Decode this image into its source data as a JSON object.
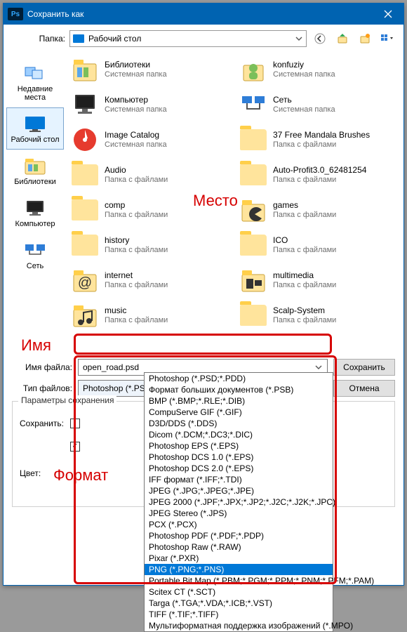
{
  "title": "Сохранить как",
  "folder_label": "Папка:",
  "folder_value": "Рабочий стол",
  "sidebar": [
    {
      "label": "Недавние\nместа",
      "kind": "recent"
    },
    {
      "label": "Рабочий стол",
      "kind": "desktop",
      "selected": true
    },
    {
      "label": "Библиотеки",
      "kind": "libs"
    },
    {
      "label": "Компьютер",
      "kind": "pc"
    },
    {
      "label": "Сеть",
      "kind": "net"
    }
  ],
  "items": [
    {
      "name": "Библиотеки",
      "sub": "Системная папка",
      "kind": "libs"
    },
    {
      "name": "konfuziy",
      "sub": "Системная папка",
      "kind": "user"
    },
    {
      "name": "Компьютер",
      "sub": "Системная папка",
      "kind": "pc"
    },
    {
      "name": "Сеть",
      "sub": "Системная папка",
      "kind": "net"
    },
    {
      "name": "Image Catalog",
      "sub": "Системная папка",
      "kind": "catalog"
    },
    {
      "name": "37 Free Mandala Brushes",
      "sub": "Папка с файлами",
      "kind": "folder"
    },
    {
      "name": "Audio",
      "sub": "Папка с файлами",
      "kind": "folder"
    },
    {
      "name": "Auto-Profit3.0_62481254",
      "sub": "Папка с файлами",
      "kind": "folder"
    },
    {
      "name": "comp",
      "sub": "Папка с файлами",
      "kind": "folder"
    },
    {
      "name": "games",
      "sub": "Папка с файлами",
      "kind": "games"
    },
    {
      "name": "history",
      "sub": "Папка с файлами",
      "kind": "folder"
    },
    {
      "name": "ICO",
      "sub": "Папка с файлами",
      "kind": "folder"
    },
    {
      "name": "internet",
      "sub": "Папка с файлами",
      "kind": "internet"
    },
    {
      "name": "multimedia",
      "sub": "Папка с файлами",
      "kind": "mm"
    },
    {
      "name": "music",
      "sub": "Папка с файлами",
      "kind": "music"
    },
    {
      "name": "Scalp-System",
      "sub": "Папка с файлами",
      "kind": "folder"
    }
  ],
  "filename_label": "Имя файла:",
  "filename_value": "open_road.psd",
  "filetype_label": "Тип файлов:",
  "filetype_value": "Photoshop (*.PSD;*.PDD)",
  "btn_save": "Сохранить",
  "btn_cancel": "Отмена",
  "group_title": "Параметры сохранения",
  "save_label": "Сохранить:",
  "color_label": "Цвет:",
  "dropdown": {
    "selected": "PNG (*.PNG;*.PNS)",
    "opts": [
      "Photoshop (*.PSD;*.PDD)",
      "Формат больших документов (*.PSB)",
      "BMP (*.BMP;*.RLE;*.DIB)",
      "CompuServe GIF (*.GIF)",
      "D3D/DDS (*.DDS)",
      "Dicom (*.DCM;*.DC3;*.DIC)",
      "Photoshop EPS (*.EPS)",
      "Photoshop DCS 1.0 (*.EPS)",
      "Photoshop DCS 2.0 (*.EPS)",
      "IFF формат (*.IFF;*.TDI)",
      "JPEG (*.JPG;*.JPEG;*.JPE)",
      "JPEG 2000 (*.JPF;*.JPX;*.JP2;*.J2C;*.J2K;*.JPC)",
      "JPEG Stereo (*.JPS)",
      "PCX (*.PCX)",
      "Photoshop PDF (*.PDF;*.PDP)",
      "Photoshop Raw (*.RAW)",
      "Pixar (*.PXR)",
      "PNG (*.PNG;*.PNS)",
      "Portable Bit Map (*.PBM;*.PGM;*.PPM;*.PNM;*.PFM;*.PAM)",
      "Scitex CT (*.SCT)",
      "Targa (*.TGA;*.VDA;*.ICB;*.VST)",
      "TIFF (*.TIF;*.TIFF)",
      "Мультиформатная поддержка изображений  (*.MPO)"
    ]
  },
  "annotations": {
    "place": "Место",
    "name": "Имя",
    "format": "Формат"
  }
}
